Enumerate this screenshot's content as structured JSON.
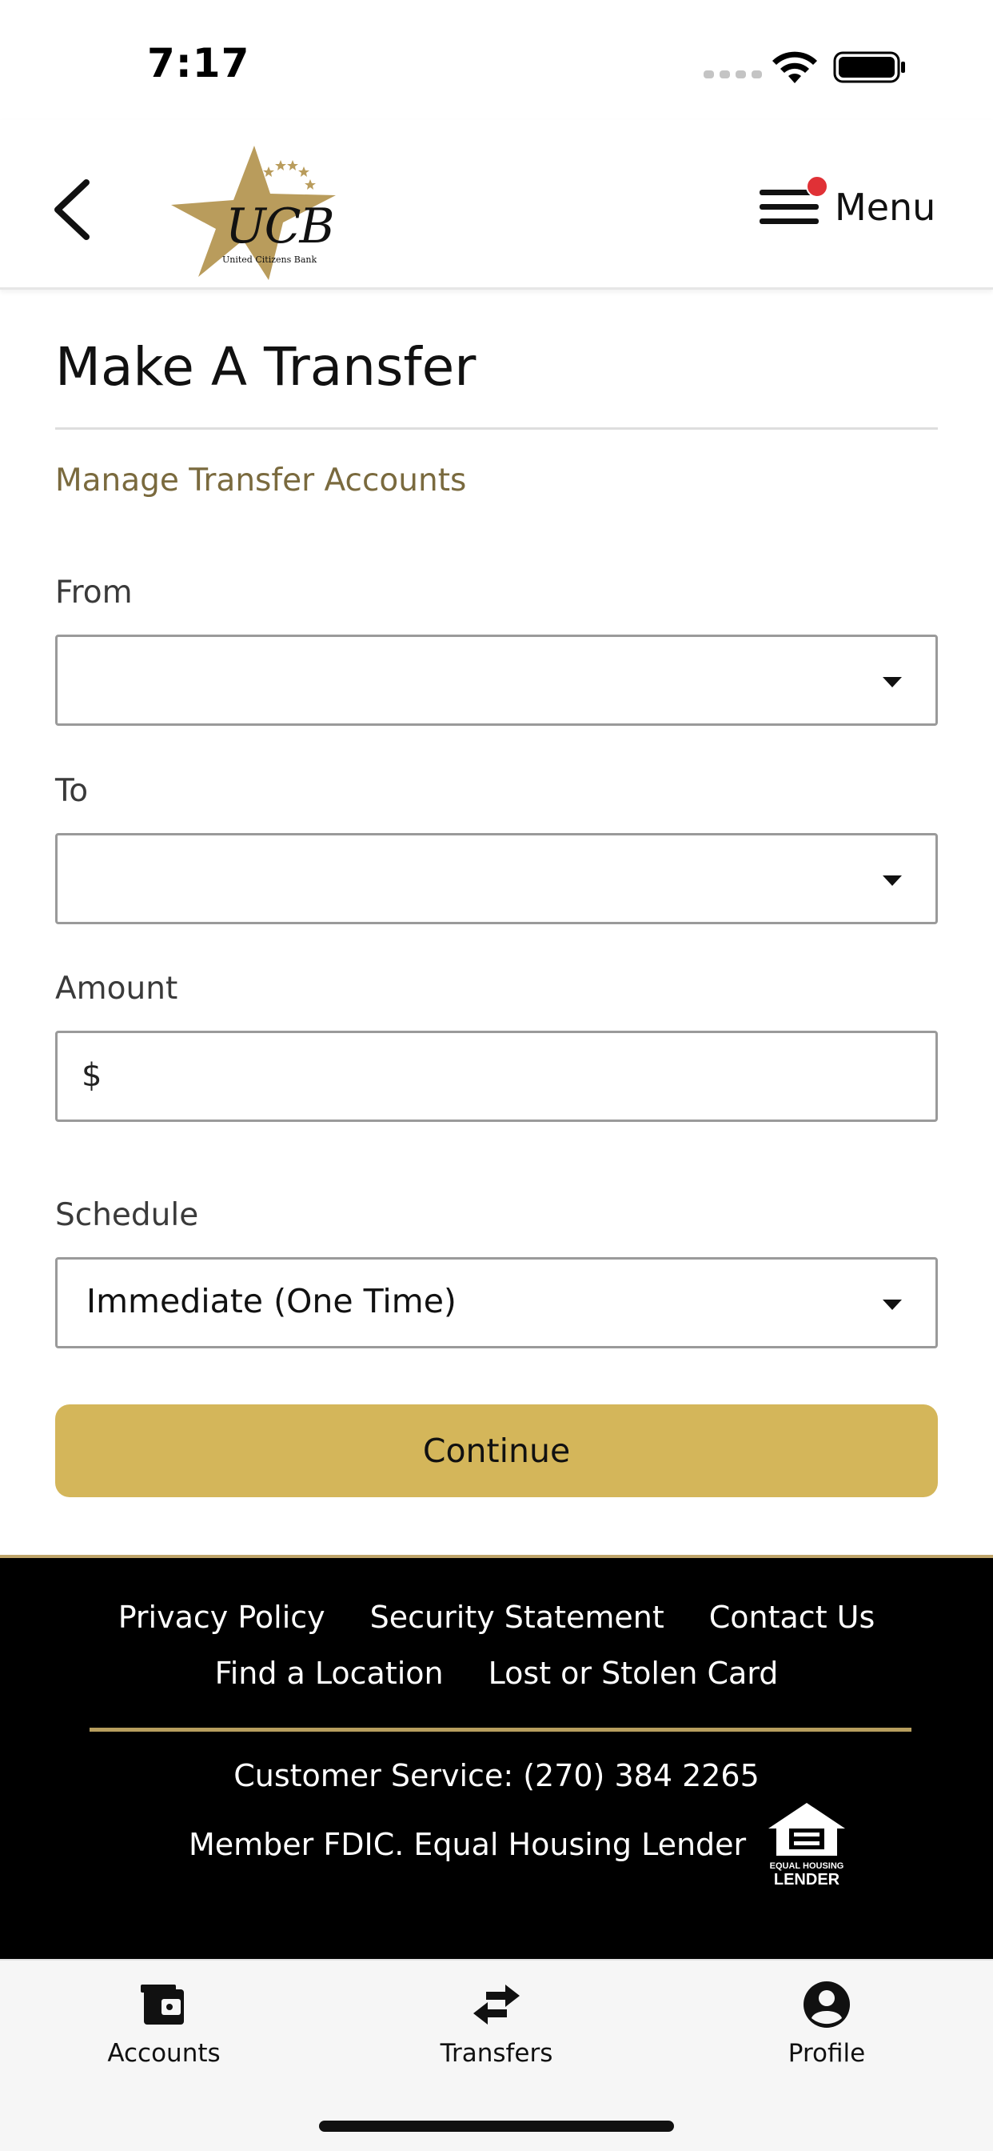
{
  "status_bar": {
    "time": "7:17"
  },
  "header": {
    "back_icon": "chevron-left-icon",
    "logo": {
      "letters": "UCB",
      "name": "United Citizens Bank",
      "color": "#b99c5c"
    },
    "menu_label": "Menu",
    "menu_badge_color": "#e03136"
  },
  "page": {
    "title": "Make A Transfer",
    "manage_link": "Manage Transfer Accounts",
    "link_color": "#7a6a3e"
  },
  "form": {
    "from": {
      "label": "From",
      "value": ""
    },
    "to": {
      "label": "To",
      "value": ""
    },
    "amount": {
      "label": "Amount",
      "currency_symbol": "$",
      "value": ""
    },
    "schedule": {
      "label": "Schedule",
      "value": "Immediate (One Time)"
    },
    "continue_label": "Continue",
    "continue_color": "#d4b65a"
  },
  "footer": {
    "links_row1": [
      "Privacy Policy",
      "Security Statement",
      "Contact Us"
    ],
    "links_row2": [
      "Find a Location",
      "Lost or Stolen Card"
    ],
    "customer_service": "Customer Service: (270) 384 2265",
    "fdic": "Member FDIC. Equal Housing Lender",
    "ehl_logo_text": [
      "EQUAL HOUSING",
      "LENDER"
    ],
    "rule_color": "#b79e5e"
  },
  "tab_bar": {
    "tabs": [
      {
        "label": "Accounts",
        "icon": "wallet-icon"
      },
      {
        "label": "Transfers",
        "icon": "transfer-arrows-icon"
      },
      {
        "label": "Profile",
        "icon": "profile-icon"
      }
    ]
  }
}
